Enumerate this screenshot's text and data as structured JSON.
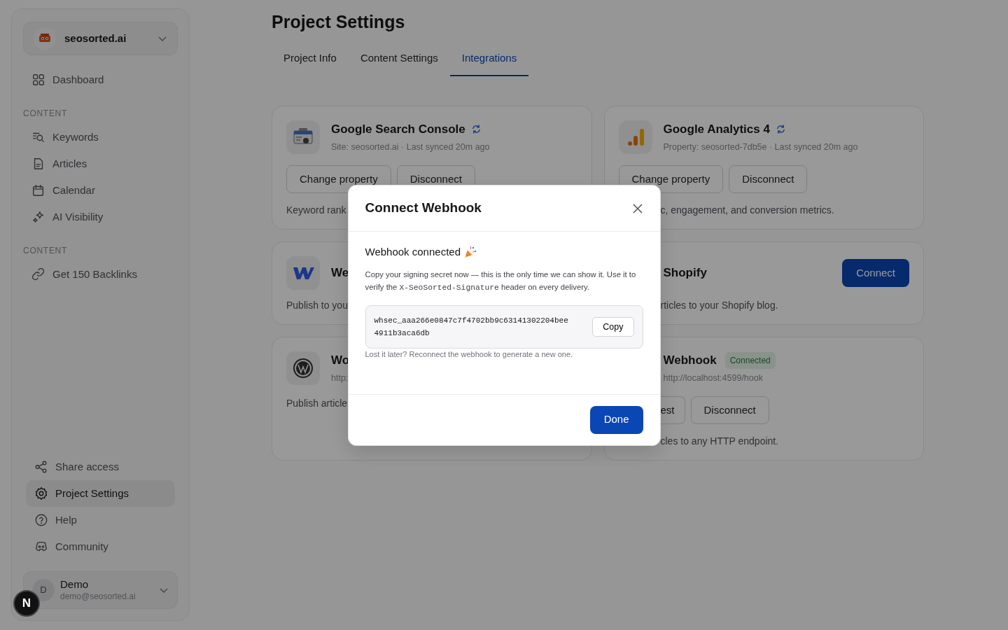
{
  "project": {
    "name": "seosorted.ai"
  },
  "sidebar": {
    "sections": [
      {
        "items": [
          {
            "label": "Dashboard",
            "selected": false
          }
        ]
      },
      {
        "heading": "CONTENT",
        "items": [
          {
            "label": "Keywords",
            "selected": false
          },
          {
            "label": "Articles",
            "selected": false
          },
          {
            "label": "Calendar",
            "selected": false
          },
          {
            "label": "AI Visibility",
            "selected": false
          }
        ]
      },
      {
        "heading": "CONTENT",
        "items": [
          {
            "label": "Get 150 Backlinks",
            "selected": false
          }
        ]
      }
    ],
    "bottom_items": [
      {
        "label": "Share access",
        "selected": false
      },
      {
        "label": "Project Settings",
        "selected": true
      },
      {
        "label": "Help",
        "selected": false
      },
      {
        "label": "Community",
        "selected": false
      }
    ]
  },
  "user": {
    "initial": "D",
    "name": "Demo",
    "email": "demo@seosorted.ai"
  },
  "dev_badge": "N",
  "page": {
    "title": "Project Settings",
    "tabs": [
      {
        "label": "Project Info",
        "selected": false
      },
      {
        "label": "Content Settings",
        "selected": false
      },
      {
        "label": "Integrations",
        "selected": true
      }
    ]
  },
  "integrations": [
    {
      "title": "Google Search Console",
      "meta": "Site: seosorted.ai · Last synced 20m ago",
      "buttons": [
        "Change property",
        "Disconnect"
      ],
      "description": "Keyword rank"
    },
    {
      "title": "Google Analytics 4",
      "meta": "Property: seosorted-7db5e · Last synced 20m ago",
      "buttons": [
        "Change property",
        "Disconnect"
      ],
      "description": "c, engagement, and conversion metrics."
    },
    {
      "title": "We",
      "description": "Publish to you"
    },
    {
      "title": "Shopify",
      "connect_button": "Connect",
      "description": "rticles to your Shopify blog."
    },
    {
      "title": "Wo",
      "meta": "http:",
      "description": "Publish article"
    },
    {
      "title": "Webhook",
      "badge": "Connected",
      "meta": "http://localhost:4599/hook",
      "buttons": [
        "est",
        "Disconnect"
      ],
      "description": "cles to any HTTP endpoint."
    }
  ],
  "modal": {
    "title": "Connect Webhook",
    "status": "Webhook connected",
    "text_before": "Copy your signing secret now — this is the only time we can show it. Use it to verify the ",
    "code": "X-SeoSorted-Signature",
    "text_after": " header on every delivery.",
    "secret": "whsec_aaa266e0847c7f4702bb9c63141302204bee4911b3aca6db",
    "copy_button": "Copy",
    "hint": "Lost it later? Reconnect the webhook to generate a new one.",
    "done_button": "Done"
  }
}
